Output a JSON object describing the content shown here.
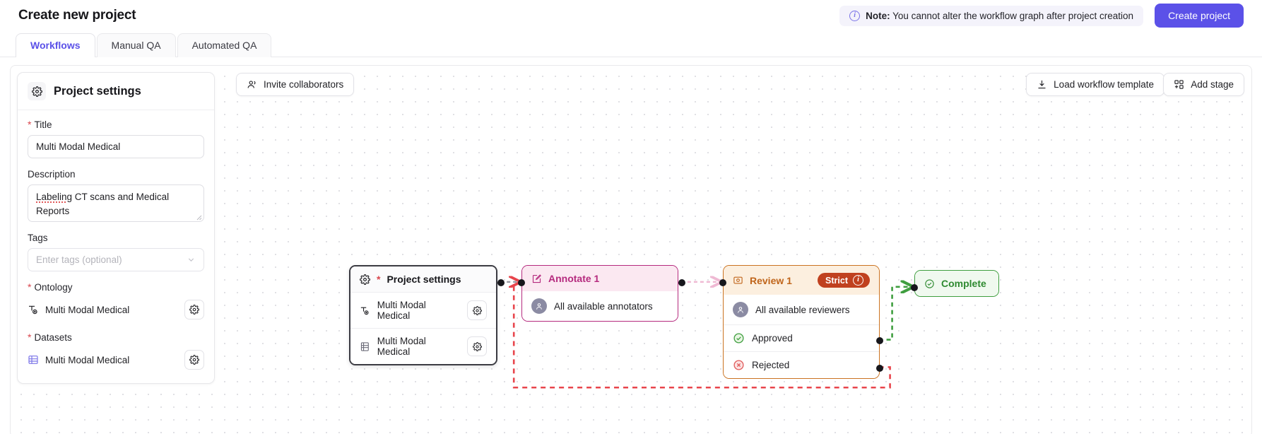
{
  "header": {
    "title": "Create new project",
    "note_label": "Note:",
    "note_text": "You cannot alter the workflow graph after project creation",
    "info_glyph": "i",
    "create_button": "Create project"
  },
  "tabs": [
    {
      "label": "Workflows",
      "active": true
    },
    {
      "label": "Manual QA",
      "active": false
    },
    {
      "label": "Automated QA",
      "active": false
    }
  ],
  "settings_panel": {
    "title": "Project settings",
    "gear_icon": "gear-icon",
    "title_field": {
      "label": "Title",
      "required": "*",
      "value": "Multi Modal Medical"
    },
    "description_field": {
      "label": "Description",
      "value_misspelled": "Labeling",
      "value_rest": " CT scans and Medical Reports"
    },
    "tags_field": {
      "label": "Tags",
      "placeholder": "Enter tags (optional)",
      "value": ""
    },
    "ontology_field": {
      "label": "Ontology",
      "required": "*",
      "value": "Multi Modal Medical",
      "icon": "ontology-icon"
    },
    "datasets_field": {
      "label": "Datasets",
      "required": "*",
      "value": "Multi Modal Medical",
      "icon": "dataset-icon"
    }
  },
  "toolbar": {
    "invite_label": "Invite collaborators",
    "invite_icon": "people-icon",
    "load_label": "Load workflow template",
    "load_icon": "download-icon",
    "add_stage_label": "Add stage",
    "add_stage_icon": "add-stage-icon"
  },
  "graph": {
    "nodes": [
      {
        "id": "project",
        "title": "Project settings",
        "required": "*",
        "icon": "gear-icon",
        "rows": [
          {
            "label": "Multi Modal Medical",
            "icon": "ontology-icon",
            "action_icon": "gear-icon"
          },
          {
            "label": "Multi Modal Medical",
            "icon": "dataset-icon",
            "action_icon": "gear-icon"
          }
        ]
      },
      {
        "id": "annotate",
        "title": "Annotate 1",
        "icon": "annotate-icon",
        "rows": [
          {
            "label": "All available annotators",
            "icon": "users-avatar"
          }
        ]
      },
      {
        "id": "review",
        "title": "Review 1",
        "icon": "review-icon",
        "badge": {
          "label": "Strict",
          "info_glyph": "i"
        },
        "rows": [
          {
            "label": "All available reviewers",
            "icon": "users-avatar"
          },
          {
            "label": "Approved",
            "icon": "check-circle-icon"
          },
          {
            "label": "Rejected",
            "icon": "x-circle-icon"
          }
        ]
      },
      {
        "id": "complete",
        "title": "Complete",
        "icon": "check-circle-icon",
        "rows": []
      }
    ],
    "colors": {
      "project_border": "#3b3b42",
      "annotate": "#b52a7e",
      "review": "#cb7321",
      "complete": "#3f9e3f",
      "strict_badge": "#c0411f",
      "edge_reject": "#e8454c",
      "edge_approve": "#3f9e3f",
      "accent": "#5b51e8"
    }
  }
}
